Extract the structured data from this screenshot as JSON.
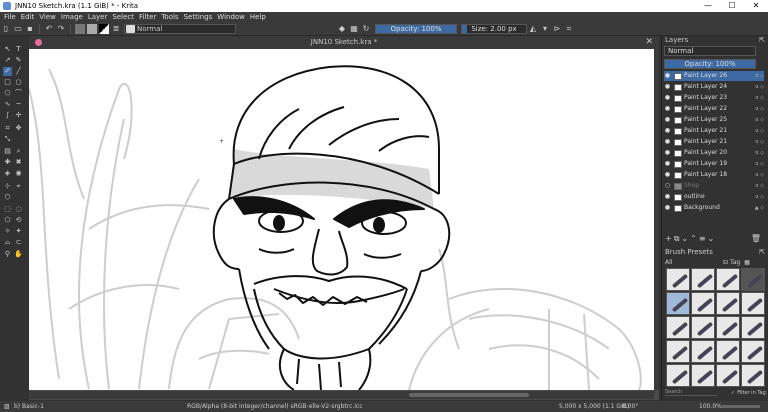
{
  "window": {
    "title": "JNN10 Sketch.kra (1.1 GiB)  * - Krita",
    "min": "—",
    "max": "☐",
    "close": "✕"
  },
  "menu": [
    "File",
    "Edit",
    "View",
    "Image",
    "Layer",
    "Select",
    "Filter",
    "Tools",
    "Settings",
    "Window",
    "Help"
  ],
  "toolbar": {
    "blend_mode": "Normal",
    "opacity": "Opacity: 100%",
    "size": "Size: 2.00 px"
  },
  "document": {
    "tab_title": "JNN10 Sketch.kra *",
    "close": "✕"
  },
  "layers_panel": {
    "title": "Layers",
    "blend_mode": "Normal",
    "opacity": "Opacity: 100%",
    "layers": [
      {
        "name": "Paint Layer 26",
        "selected": true
      },
      {
        "name": "Paint Layer 24"
      },
      {
        "name": "Paint Layer 23"
      },
      {
        "name": "Paint Layer 22"
      },
      {
        "name": "Paint Layer 25"
      },
      {
        "name": "Paint Layer 21"
      },
      {
        "name": "Paint Layer 21"
      },
      {
        "name": "Paint Layer 20"
      },
      {
        "name": "Paint Layer 19"
      },
      {
        "name": "Paint Layer 18"
      },
      {
        "name": "Shop",
        "dim": true
      },
      {
        "name": "outline"
      },
      {
        "name": "Background"
      }
    ]
  },
  "brush_presets": {
    "title": "Brush Presets",
    "filter": "All",
    "tag": "Tag",
    "search_placeholder": "Search",
    "filter_in_tag": "Filter in Tag"
  },
  "statusbar": {
    "brush": "b) Basic-1",
    "color_info": "RGB/Alpha (8-bit integer/channel)  sRGB-elle-V2-srgbtrc.icc",
    "image_size": "5,000 x 5,000 (1.1 GiB)",
    "rotation": "0.00°",
    "zoom": "100.0%"
  }
}
